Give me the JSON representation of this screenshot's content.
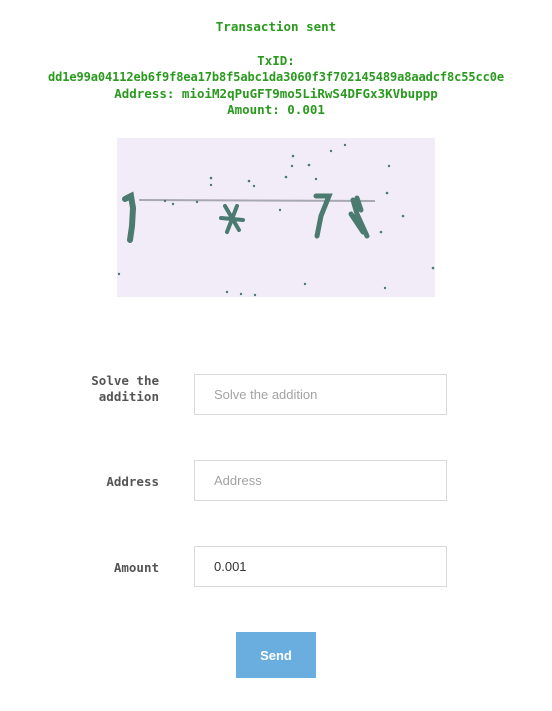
{
  "status": {
    "title": "Transaction sent",
    "txid_label": "TxID:",
    "txid": "dd1e99a04112eb6f9f8ea17b8f5abc1da3060f3f702145489a8aadcf8c55cc0e",
    "address_line": "Address: mioiM2qPuGFT9mo5LiRwS4DFGx3KVbuppp",
    "amount_line": "Amount: 0.001",
    "color": "#2a9a1f"
  },
  "captcha": {
    "background": "#f1ecf8",
    "ink": "#4a7a70"
  },
  "form": {
    "captcha_field": {
      "label": "Solve the addition",
      "placeholder": "Solve the addition",
      "value": ""
    },
    "address_field": {
      "label": "Address",
      "placeholder": "Address",
      "value": ""
    },
    "amount_field": {
      "label": "Amount",
      "placeholder": "",
      "value": "0.001"
    },
    "send_label": "Send",
    "button_color": "#6aaee0"
  }
}
